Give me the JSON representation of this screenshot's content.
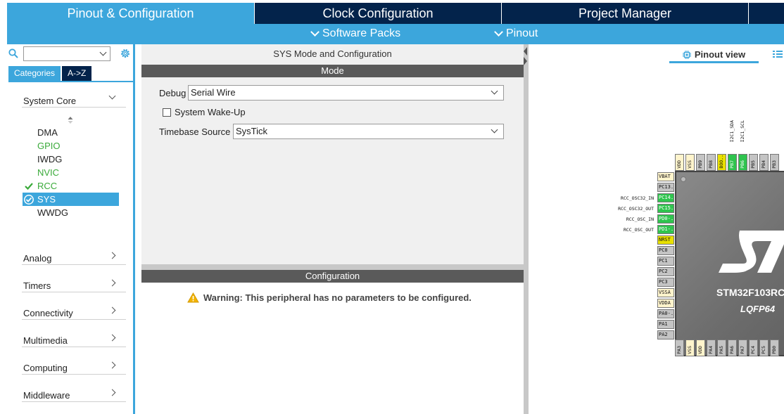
{
  "top_tabs": [
    {
      "label": "Pinout & Configuration"
    },
    {
      "label": "Clock Configuration"
    },
    {
      "label": "Project Manager"
    }
  ],
  "sub_menu": {
    "software_packs": "Software Packs",
    "pinout": "Pinout"
  },
  "sidebar": {
    "category_tabs": [
      "Categories",
      "A->Z"
    ],
    "system_core": {
      "label": "System Core",
      "expanded": true
    },
    "peripherals": [
      {
        "label": "DMA",
        "state": "normal"
      },
      {
        "label": "GPIO",
        "state": "green"
      },
      {
        "label": "IWDG",
        "state": "normal"
      },
      {
        "label": "NVIC",
        "state": "green"
      },
      {
        "label": "RCC",
        "state": "checked"
      },
      {
        "label": "SYS",
        "state": "selected"
      },
      {
        "label": "WWDG",
        "state": "normal"
      }
    ],
    "sections": [
      "Analog",
      "Timers",
      "Connectivity",
      "Multimedia",
      "Computing",
      "Middleware"
    ]
  },
  "main": {
    "title": "SYS Mode and Configuration",
    "mode_header": "Mode",
    "debug_label": "Debug",
    "debug_value": "Serial Wire",
    "wakeup_label": "System Wake-Up",
    "wakeup_checked": false,
    "timebase_label": "Timebase Source",
    "timebase_value": "SysTick",
    "config_header": "Configuration",
    "warning": "Warning: This peripheral has no parameters to be configured."
  },
  "pinout": {
    "view_tab": "Pinout view",
    "chip_name": "STM32F103RC",
    "package": "LQFP64",
    "left_pins": [
      {
        "name": "VBAT",
        "color": "cream",
        "label": ""
      },
      {
        "name": "PC13..",
        "color": "gray",
        "label": ""
      },
      {
        "name": "PC14..",
        "color": "green",
        "label": "RCC_OSC32_IN"
      },
      {
        "name": "PC15..",
        "color": "green",
        "label": "RCC_OSC32_OUT"
      },
      {
        "name": "PD0-..",
        "color": "green",
        "label": "RCC_OSC_IN"
      },
      {
        "name": "PD1-..",
        "color": "green",
        "label": "RCC_OSC_OUT"
      },
      {
        "name": "NRST",
        "color": "yellow",
        "label": ""
      },
      {
        "name": "PC0",
        "color": "gray",
        "label": ""
      },
      {
        "name": "PC1",
        "color": "gray",
        "label": ""
      },
      {
        "name": "PC2",
        "color": "gray",
        "label": ""
      },
      {
        "name": "PC3",
        "color": "gray",
        "label": ""
      },
      {
        "name": "VSSA",
        "color": "cream",
        "label": ""
      },
      {
        "name": "VDDA",
        "color": "cream",
        "label": ""
      },
      {
        "name": "PA0-..",
        "color": "gray",
        "label": ""
      },
      {
        "name": "PA1",
        "color": "gray",
        "label": ""
      },
      {
        "name": "PA2",
        "color": "gray",
        "label": ""
      }
    ],
    "top_pins": [
      {
        "name": "VDD",
        "color": "cream",
        "label": ""
      },
      {
        "name": "VSS",
        "color": "cream",
        "label": ""
      },
      {
        "name": "PB9",
        "color": "gray",
        "label": ""
      },
      {
        "name": "PB8",
        "color": "gray",
        "label": ""
      },
      {
        "name": "BOO..",
        "color": "yellow",
        "label": ""
      },
      {
        "name": "PB7",
        "color": "green",
        "label": "I2C1_SDA"
      },
      {
        "name": "PB6",
        "color": "green",
        "label": "I2C1_SCL"
      },
      {
        "name": "PB5",
        "color": "gray",
        "label": ""
      },
      {
        "name": "PB4",
        "color": "gray",
        "label": ""
      },
      {
        "name": "PB3",
        "color": "gray",
        "label": ""
      }
    ],
    "bottom_pins": [
      {
        "name": "PA3",
        "color": "gray"
      },
      {
        "name": "VSS",
        "color": "cream"
      },
      {
        "name": "VDD",
        "color": "cream"
      },
      {
        "name": "PA4",
        "color": "gray"
      },
      {
        "name": "PA5",
        "color": "gray"
      },
      {
        "name": "PA6",
        "color": "gray"
      },
      {
        "name": "PA7",
        "color": "gray"
      },
      {
        "name": "PC4",
        "color": "gray"
      },
      {
        "name": "PC5",
        "color": "gray"
      },
      {
        "name": "PB0",
        "color": "gray"
      }
    ]
  },
  "colors": {
    "accent": "#3ca6dc",
    "dark_tab": "#03234b",
    "active_green": "#2fc44e",
    "pin_yellow": "#e8e000"
  }
}
